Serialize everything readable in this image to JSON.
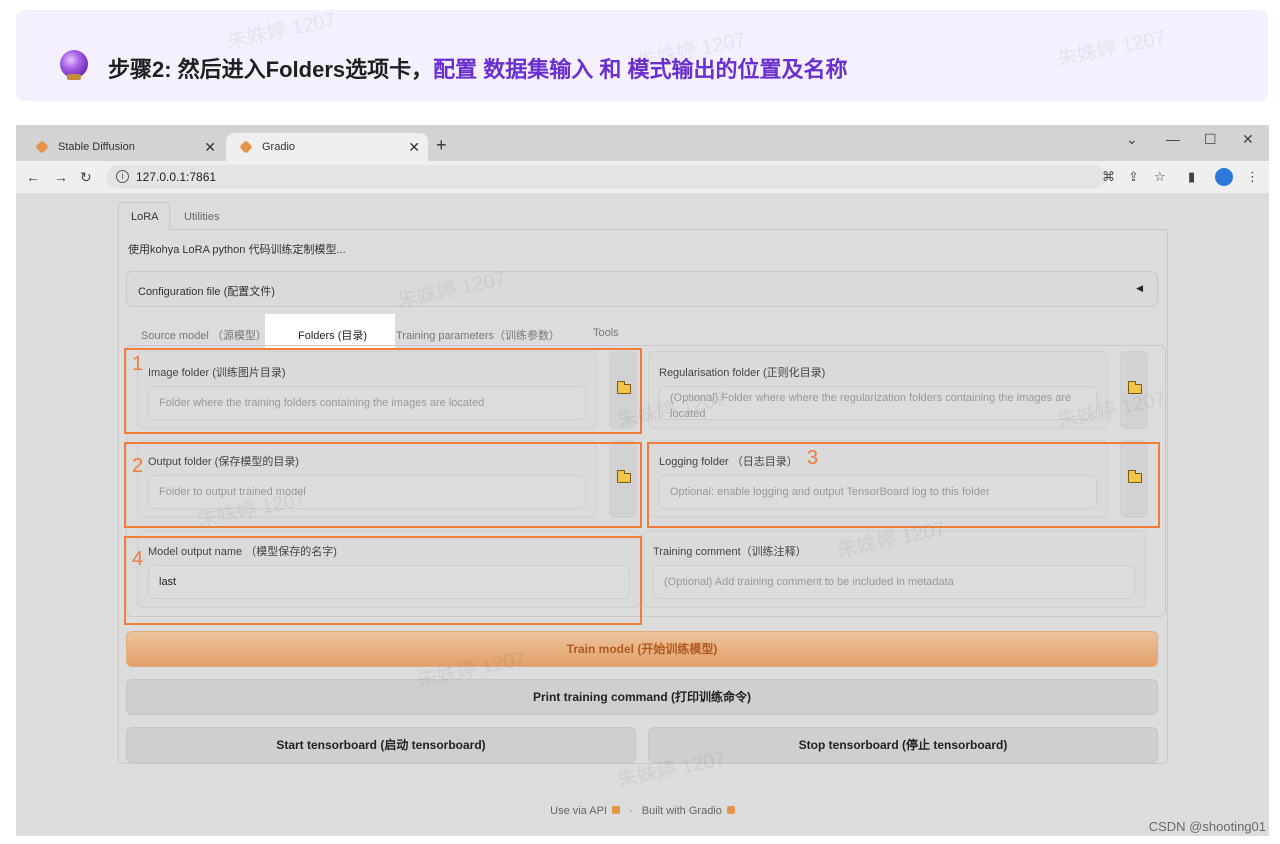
{
  "banner": {
    "prefix": "步骤2: 然后进入Folders选项卡，",
    "highlight": "配置 数据集输入 和 模式输出的位置及名称"
  },
  "browser": {
    "tabs": [
      {
        "label": "Stable Diffusion"
      },
      {
        "label": "Gradio"
      }
    ],
    "url": "127.0.0.1:7861"
  },
  "app": {
    "tabs": [
      "LoRA",
      "Utilities"
    ],
    "description": "使用kohya LoRA python 代码训练定制模型...",
    "config_label": "Configuration file (配置文件)",
    "sub_tabs": [
      "Source model （源模型）",
      "Folders (目录)",
      "Training parameters（训练参数）",
      "Tools"
    ],
    "fields": {
      "image_folder": {
        "label": "Image folder (训练图片目录)",
        "placeholder": "Folder where the training folders containing the images are located"
      },
      "reg_folder": {
        "label": "Regularisation folder (正则化目录)",
        "placeholder": "(Optional) Folder where where the regularization folders containing the images are located"
      },
      "output_folder": {
        "label": "Output folder (保存模型的目录)",
        "placeholder": "Folder to output trained model"
      },
      "logging_folder": {
        "label": "Logging folder （日志目录）",
        "placeholder": "Optional: enable logging and output TensorBoard log to this folder"
      },
      "model_output_name": {
        "label": "Model output name （模型保存的名字)",
        "value": "last"
      },
      "training_comment": {
        "label": "Training comment（训练注释）",
        "placeholder": "(Optional) Add training comment to be included in metadata"
      }
    },
    "buttons": {
      "train": "Train model (开始训练模型)",
      "print_cmd": "Print training command (打印训练命令)",
      "start_tb": "Start tensorboard (启动 tensorboard)",
      "stop_tb": "Stop tensorboard (停止 tensorboard)"
    },
    "footer": {
      "api": "Use via API",
      "built": "Built with Gradio"
    }
  },
  "annotations": {
    "n1": "1",
    "n2": "2",
    "n3": "3",
    "n4": "4"
  },
  "watermark": "朱姝婷 1207",
  "credit": "CSDN @shooting01",
  "colors": {
    "accent": "#ef7d3c",
    "highlight": "#6a2fd0"
  }
}
